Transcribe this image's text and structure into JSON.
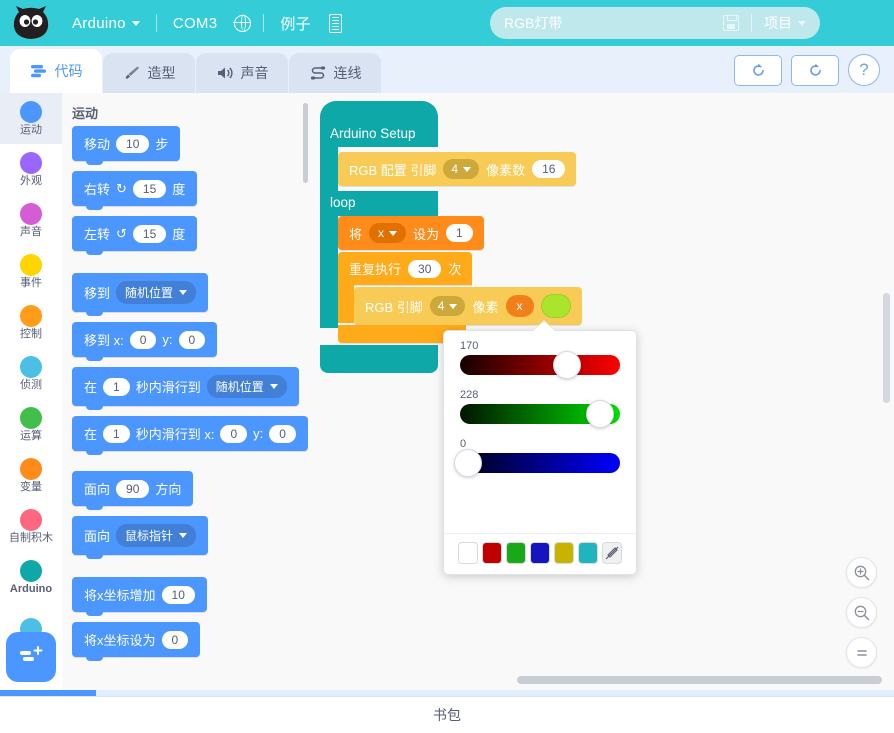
{
  "menubar": {
    "logo_name": "cat-logo",
    "items": [
      {
        "label": "Arduino",
        "has_caret": true
      },
      {
        "label": "COM3",
        "has_caret": false
      },
      {
        "label": "例子",
        "has_caret": false
      }
    ],
    "globe_icon": "globe-icon",
    "chip_icon": "chip-icon",
    "project": {
      "name": "RGB灯带",
      "save_icon": "save-icon",
      "menu_label": "项目"
    }
  },
  "tabs": [
    {
      "label": "代码",
      "icon": "code-icon",
      "active": true
    },
    {
      "label": "造型",
      "icon": "paintbrush-icon",
      "active": false
    },
    {
      "label": "声音",
      "icon": "speaker-icon",
      "active": false
    },
    {
      "label": "连线",
      "icon": "connect-icon",
      "active": false
    }
  ],
  "toolbar_right": {
    "upload_label": "upload-icon",
    "refresh_label": "refresh-icon",
    "help_label": "?"
  },
  "categories": [
    {
      "label": "运动",
      "color": "#4c97ff",
      "selected": true
    },
    {
      "label": "外观",
      "color": "#9966ff",
      "selected": false
    },
    {
      "label": "声音",
      "color": "#d65cd6",
      "selected": false
    },
    {
      "label": "事件",
      "color": "#ffd500",
      "selected": false
    },
    {
      "label": "控制",
      "color": "#ff9d1a",
      "selected": false
    },
    {
      "label": "侦测",
      "color": "#4cbfe6",
      "selected": false
    },
    {
      "label": "运算",
      "color": "#40bf4a",
      "selected": false
    },
    {
      "label": "变量",
      "color": "#ff8c1a",
      "selected": false
    },
    {
      "label": "自制积木",
      "color": "#ff6680",
      "selected": false
    },
    {
      "label": "Arduino",
      "color": "#0fa8a8",
      "selected": false
    }
  ],
  "add_extension_label": "add-extension-icon",
  "palette": {
    "header": "运动",
    "blocks": [
      {
        "id": "move",
        "parts": [
          {
            "t": "text",
            "v": "移动"
          },
          {
            "t": "oval",
            "v": "10"
          },
          {
            "t": "text",
            "v": "步"
          }
        ]
      },
      {
        "id": "turn-right",
        "parts": [
          {
            "t": "text",
            "v": "右转"
          },
          {
            "t": "icon",
            "v": "↻"
          },
          {
            "t": "oval",
            "v": "15"
          },
          {
            "t": "text",
            "v": "度"
          }
        ]
      },
      {
        "id": "turn-left",
        "parts": [
          {
            "t": "text",
            "v": "左转"
          },
          {
            "t": "icon",
            "v": "↺"
          },
          {
            "t": "oval",
            "v": "15"
          },
          {
            "t": "text",
            "v": "度"
          }
        ]
      },
      {
        "id": "goto",
        "parts": [
          {
            "t": "text",
            "v": "移到"
          },
          {
            "t": "drop",
            "v": "随机位置"
          }
        ]
      },
      {
        "id": "goto-xy",
        "parts": [
          {
            "t": "text",
            "v": "移到 x:"
          },
          {
            "t": "oval",
            "v": "0"
          },
          {
            "t": "text",
            "v": "y:"
          },
          {
            "t": "oval",
            "v": "0"
          }
        ]
      },
      {
        "id": "glide-to",
        "parts": [
          {
            "t": "text",
            "v": "在"
          },
          {
            "t": "oval",
            "v": "1"
          },
          {
            "t": "text",
            "v": "秒内滑行到"
          },
          {
            "t": "drop",
            "v": "随机位置"
          }
        ]
      },
      {
        "id": "glide-xy",
        "parts": [
          {
            "t": "text",
            "v": "在"
          },
          {
            "t": "oval",
            "v": "1"
          },
          {
            "t": "text",
            "v": "秒内滑行到 x:"
          },
          {
            "t": "oval",
            "v": "0"
          },
          {
            "t": "text",
            "v": "y:"
          },
          {
            "t": "oval",
            "v": "0"
          }
        ]
      },
      {
        "id": "point-direction",
        "parts": [
          {
            "t": "text",
            "v": "面向"
          },
          {
            "t": "oval",
            "v": "90"
          },
          {
            "t": "text",
            "v": "方向"
          }
        ]
      },
      {
        "id": "point-towards",
        "parts": [
          {
            "t": "text",
            "v": "面向"
          },
          {
            "t": "drop",
            "v": "鼠标指针"
          }
        ]
      },
      {
        "id": "change-x",
        "parts": [
          {
            "t": "text",
            "v": "将x坐标增加"
          },
          {
            "t": "oval",
            "v": "10"
          }
        ]
      },
      {
        "id": "set-x",
        "parts": [
          {
            "t": "text",
            "v": "将x坐标设为"
          },
          {
            "t": "oval",
            "v": "0"
          }
        ]
      }
    ]
  },
  "script": {
    "setup_label": "Arduino Setup",
    "loop_label": "loop",
    "rgb_config": {
      "prefix": "RGB 配置 引脚",
      "pin": "4",
      "mid": "像素数",
      "count": "16"
    },
    "set_var": {
      "prefix": "将",
      "variable": "x",
      "mid": "设为",
      "value": "1"
    },
    "repeat": {
      "prefix": "重复执行",
      "times": "30",
      "suffix": "次"
    },
    "rgb_pixel": {
      "prefix": "RGB 引脚",
      "pin": "4",
      "mid": "像素",
      "index": "x",
      "color": "#aae42c"
    }
  },
  "color_picker": {
    "red": {
      "value": "170",
      "percent": 66.7,
      "track_from": "#1a0000",
      "track_to": "#ff0000"
    },
    "green": {
      "value": "228",
      "percent": 89.4,
      "track_from": "#001a00",
      "track_to": "#00e000"
    },
    "blue": {
      "value": "0",
      "percent": 0,
      "track_from": "#000019",
      "track_to": "#0000ff"
    },
    "swatches": [
      {
        "name": "swatch-white",
        "color": "#ffffff"
      },
      {
        "name": "swatch-red",
        "color": "#c00000"
      },
      {
        "name": "swatch-green",
        "color": "#18a818"
      },
      {
        "name": "swatch-blue",
        "color": "#1414c0"
      },
      {
        "name": "swatch-olive",
        "color": "#c8b400"
      },
      {
        "name": "swatch-cyan",
        "color": "#20b4c0"
      },
      {
        "name": "swatch-none",
        "color": "#f0f0f0"
      }
    ]
  },
  "zoom_controls": {
    "zoom_in": "zoom-in-icon",
    "zoom_out": "zoom-out-icon",
    "zoom_reset": "zoom-reset-icon"
  },
  "footer": {
    "backpack_label": "书包"
  }
}
